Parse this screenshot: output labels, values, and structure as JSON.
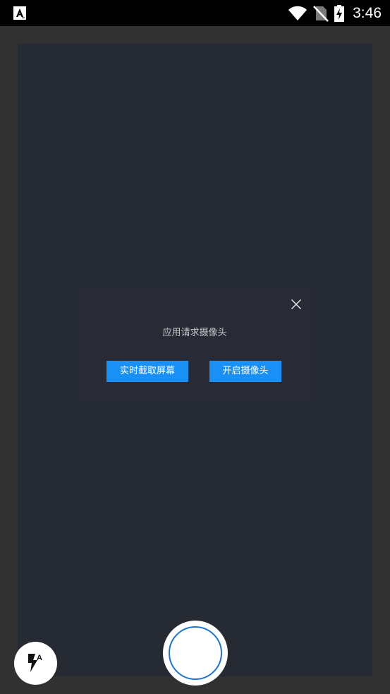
{
  "status_bar": {
    "time": "3:46",
    "icons": [
      "app-notification-icon",
      "wifi-icon",
      "no-sim-icon",
      "battery-charging-icon"
    ]
  },
  "dialog": {
    "message": "应用请求摄像头",
    "buttons": {
      "capture_screen": "实时截取屏幕",
      "open_camera": "开启摄像头"
    },
    "close_icon": "close-icon"
  },
  "controls": {
    "flash_icon": "flash-auto-icon",
    "shutter_icon": "shutter-icon"
  },
  "colors": {
    "background": "#313131",
    "viewfinder": "#252a33",
    "dialog": "#282b36",
    "accent": "#1890f5",
    "shutter_ring": "#1b74d2"
  }
}
